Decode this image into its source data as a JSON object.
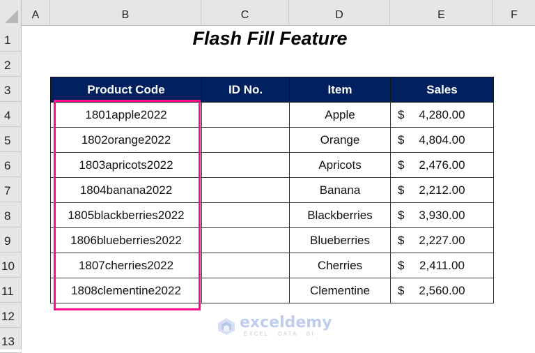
{
  "spreadsheet": {
    "columns": [
      "A",
      "B",
      "C",
      "D",
      "E",
      "F"
    ],
    "rows": [
      "1",
      "2",
      "3",
      "4",
      "5",
      "6",
      "7",
      "8",
      "9",
      "10",
      "11",
      "12",
      "13"
    ]
  },
  "sheet": {
    "title": "Flash Fill Feature",
    "table": {
      "headers": [
        "Product Code",
        "ID No.",
        "Item",
        "Sales"
      ],
      "rows": [
        {
          "product_code": "1801apple2022",
          "id_no": "",
          "item": "Apple",
          "currency": "$",
          "sales": "4,280.00"
        },
        {
          "product_code": "1802orange2022",
          "id_no": "",
          "item": "Orange",
          "currency": "$",
          "sales": "4,804.00"
        },
        {
          "product_code": "1803apricots2022",
          "id_no": "",
          "item": "Apricots",
          "currency": "$",
          "sales": "2,476.00"
        },
        {
          "product_code": "1804banana2022",
          "id_no": "",
          "item": "Banana",
          "currency": "$",
          "sales": "2,212.00"
        },
        {
          "product_code": "1805blackberries2022",
          "id_no": "",
          "item": "Blackberries",
          "currency": "$",
          "sales": "3,930.00"
        },
        {
          "product_code": "1806blueberries2022",
          "id_no": "",
          "item": "Blueberries",
          "currency": "$",
          "sales": "2,227.00"
        },
        {
          "product_code": "1807cherries2022",
          "id_no": "",
          "item": "Cherries",
          "currency": "$",
          "sales": "2,411.00"
        },
        {
          "product_code": "1808clementine2022",
          "id_no": "",
          "item": "Clementine",
          "currency": "$",
          "sales": "2,560.00"
        }
      ]
    }
  },
  "colors": {
    "header_fill": "#002060",
    "highlight_border": "#ff0a8c"
  },
  "watermark": {
    "name": "exceldemy",
    "tagline": "EXCEL · DATA · BI"
  }
}
